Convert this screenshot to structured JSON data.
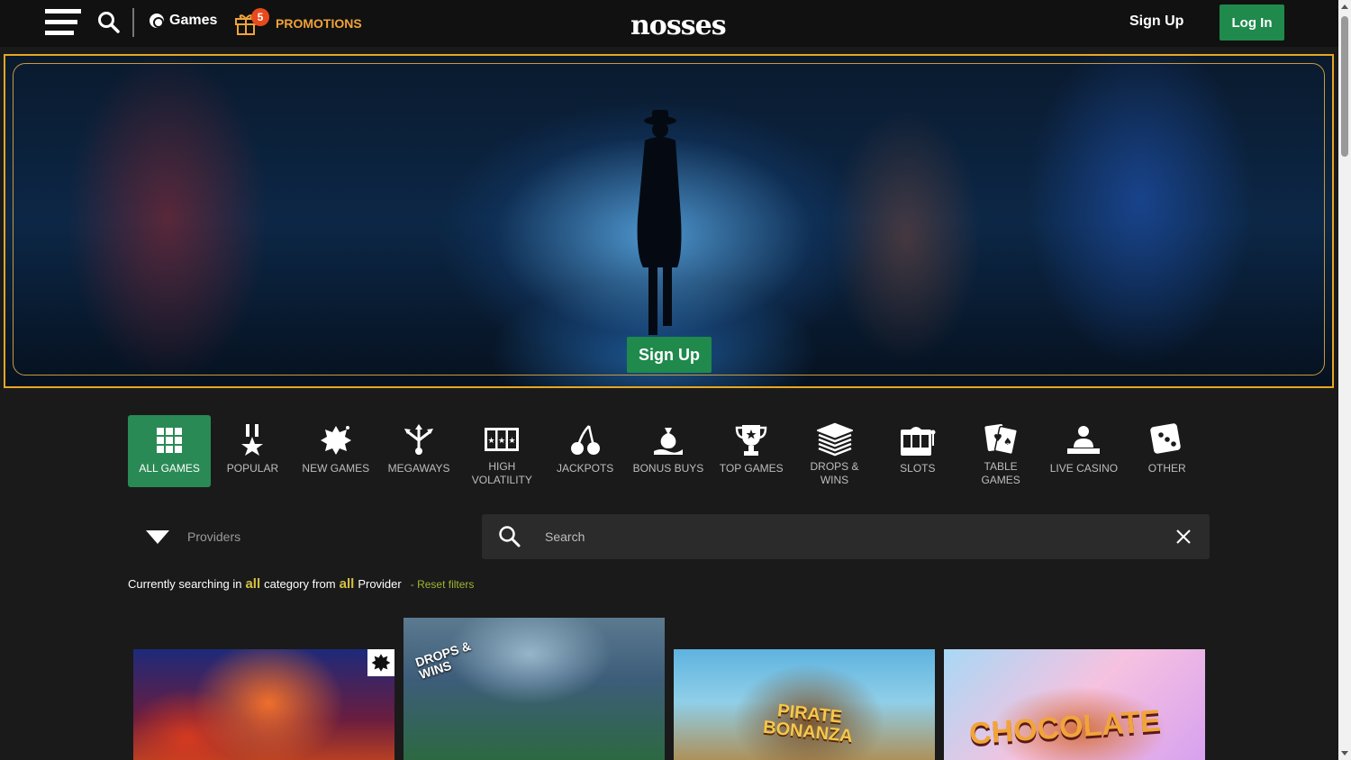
{
  "header": {
    "games_label": "Games",
    "promotions_label": "PROMOTIONS",
    "promotions_count": "5",
    "logo_text": "nosses",
    "signup_label": "Sign Up",
    "login_label": "Log In"
  },
  "hero": {
    "signup_label": "Sign Up"
  },
  "categories": [
    {
      "label": "ALL GAMES",
      "icon": "grid-icon",
      "active": true
    },
    {
      "label": "POPULAR",
      "icon": "medal-icon"
    },
    {
      "label": "NEW GAMES",
      "icon": "starburst-icon"
    },
    {
      "label": "MEGAWAYS",
      "icon": "branching-arrows-icon"
    },
    {
      "label": "HIGH VOLATILITY",
      "icon": "triple-star-icon"
    },
    {
      "label": "JACKPOTS",
      "icon": "cherries-icon"
    },
    {
      "label": "BONUS BUYS",
      "icon": "money-bag-hand-icon"
    },
    {
      "label": "TOP GAMES",
      "icon": "trophy-icon"
    },
    {
      "label": "DROPS & WINS",
      "icon": "cash-stack-icon"
    },
    {
      "label": "SLOTS",
      "icon": "slot-machine-icon"
    },
    {
      "label": "TABLE GAMES",
      "icon": "playing-cards-icon"
    },
    {
      "label": "LIVE CASINO",
      "icon": "dealer-icon"
    },
    {
      "label": "OTHER",
      "icon": "dice-icon"
    }
  ],
  "filters": {
    "providers_label": "Providers",
    "search_placeholder": "Search",
    "status_prefix": "Currently searching in",
    "status_category": "all",
    "status_mid": "category from",
    "status_provider": "all",
    "status_suffix": "Provider",
    "reset_label": "- Reset filters"
  },
  "games": [
    {
      "title": ""
    },
    {
      "title": "DROPS & WINS"
    },
    {
      "title": "PIRATE BONANZA"
    },
    {
      "title": "CHOCOLATE"
    }
  ],
  "colors": {
    "accent_green": "#1f8a4c",
    "promo_orange": "#f0a33a",
    "hero_border": "#e6a723",
    "highlight_yellow": "#d5c040"
  }
}
